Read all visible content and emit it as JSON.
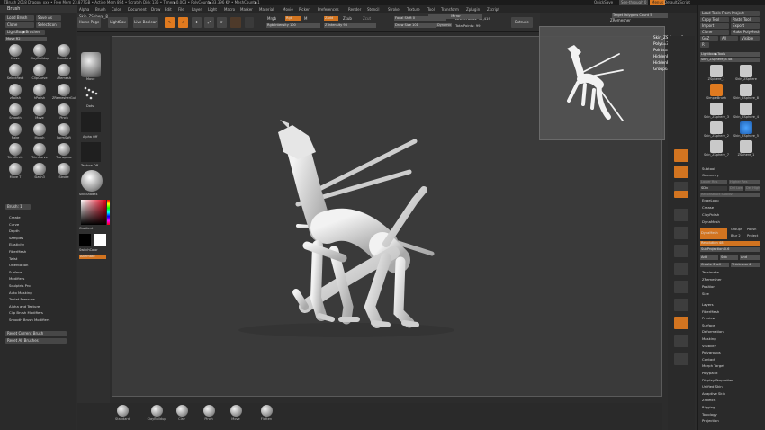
{
  "titlebar": {
    "text": "ZBrush 2018   Dragon_xxx  •  Free Mem 23.877GB  •  Active Mem 894  •  Scratch Disk 136  •  Timer▶0.003  •  PolyCount▶33.396 KP  •  MeshCount▶1",
    "quicksave": "QuickSave",
    "seethrough": "See-through   0",
    "menus_label": "Menus",
    "default_script": "DefaultZScript"
  },
  "menu": [
    "Alpha",
    "Brush",
    "Color",
    "Document",
    "Draw",
    "Edit",
    "File",
    "Layer",
    "Light",
    "Macro",
    "Marker",
    "Material",
    "Movie",
    "Picker",
    "Preferences",
    "Render",
    "Stencil",
    "Stroke",
    "Texture",
    "Tool",
    "Transform",
    "Zplugin",
    "Zscript"
  ],
  "brush_panel": {
    "title": "Brush",
    "buttons": [
      "Load Brush",
      "Save As",
      "Clone",
      "SelectIcon",
      "LightBox▶Brushes"
    ],
    "size_label": "Move  R2",
    "brushes": [
      "Move",
      "ClayBuildup",
      "Standard",
      "SelectRect",
      "ClipCurve",
      "zRemesh",
      "zPolish",
      "hPolish",
      "ZRemesherGuide",
      "Smooth",
      "Move",
      "Pinch",
      "Rake",
      "Morph",
      "FormSoft",
      "TrimCircle",
      "TrimCurve",
      "Transpose",
      "Move T",
      "Slash3",
      "Stroke"
    ],
    "stroke_label": "Brush: 1",
    "modifiers": [
      "Create",
      "Curve",
      "Depth",
      "Samples",
      "Elasticity",
      "FiberMesh",
      "Twist",
      "Orientation",
      "Surface",
      "Modifiers",
      "Sculptris Pro",
      "Auto Masking",
      "Tablet Pressure",
      "Alpha and Texture",
      "Clip Brush Modifiers",
      "Smooth Brush Modifiers"
    ],
    "reset_buttons": [
      "Reset Current Brush",
      "Reset All Brushes"
    ]
  },
  "shelf": {
    "tool_name": "Skin_ZSphere_8",
    "buttons": [
      "Home Page",
      "LightBox",
      "Live Boolean"
    ],
    "draw_labels": [
      "Edit",
      "Draw",
      "Move",
      "Scale",
      "Rotate"
    ],
    "mrgb": "Mrgb",
    "rgb": "Rgb",
    "m": "M",
    "rgb_intensity": "Rgb Intensity  100",
    "zadd": "Zadd",
    "zsub": "Zsub",
    "zcut": "Zcut",
    "z_intensity": "Z Intensity 93",
    "focal_shift": "Focal Shift  0",
    "draw_size": "Draw Size  101",
    "dynamic": "Dynamic",
    "active_points": "ActivePoints: 32,419",
    "total_points": "TotalPoints: 99",
    "extrude": "Extrude",
    "mirror": "Mirror",
    "zremesher": "ZRemesher",
    "target_polys": "Target Polygons Count  5"
  },
  "left_secondary": [
    "Move",
    "Dots",
    "Alpha Off",
    "Texture Off",
    "SkinShade4",
    "Gradient",
    "SwitchColor",
    "Alternate"
  ],
  "nav_info": {
    "name": "Skin_ZSphere_8",
    "polys": "Polys=33594",
    "points": "Points=32419",
    "hidden_polys": "HiddenPolys=0",
    "hidden_points": "HiddenPoints=0",
    "groups": "Groups=3"
  },
  "bottom_brushes": [
    "Standard",
    "ClayBuildup",
    "Clay",
    "Pinch",
    "Move",
    "Flatten"
  ],
  "right_panel": {
    "top_buttons": [
      "Load Tools From Project",
      "Copy Tool",
      "Paste Tool",
      "Import",
      "Export",
      "Clone",
      "Make PolyMesh3D",
      "GoZ",
      "All",
      "Visible",
      "R"
    ],
    "lightbox_tools": "Lightbox▶Tools",
    "zsphere_label": "Skin_ZSphere_8   48",
    "tools": [
      "ZSphere_1",
      "Skin_ZSphere",
      "SimpleBrush",
      "Skin_ZSphere_8",
      "Skin_ZSphere_3",
      "Skin_ZSphere_4",
      "Skin_ZSphere_2",
      "Skin_ZSphere_5",
      "Skin_ZSphere_7",
      "ZSphere_1"
    ],
    "sections": [
      "Subtool",
      "Geometry"
    ],
    "geometry_buttons": [
      "Lower Res",
      "Higher Res",
      "SDiv",
      "Del Lower",
      "Del Higher",
      "Reconstruct Subdiv",
      "EdgeLoop",
      "Crease",
      "ClayPolish",
      "DynaMesh"
    ],
    "dynamesh": {
      "label": "DynaMesh",
      "groups": "Groups",
      "polish": "Polish",
      "blur": "Blur 2",
      "project": "Project",
      "resolution": "Resolution 48",
      "subprojection": "SubProjection 0.6",
      "add": "Add",
      "sub": "Sub",
      "and": "And",
      "create_shell": "Create Shell",
      "thickness": "Thickness 4"
    },
    "more": [
      "Tessimate",
      "ZRemesher",
      "Position",
      "Size"
    ],
    "lower_list": [
      "Layers",
      "FiberMesh",
      "Preview",
      "Surface",
      "Deformation",
      "Masking",
      "Visibility",
      "Polygroups",
      "Contact",
      "Morph Target",
      "Polypaint",
      "Display Properties",
      "Unified Skin",
      "Adaptive Skin",
      "ZSketch",
      "Rigging",
      "Topology",
      "Projection"
    ]
  },
  "colors": {
    "accent": "#e07a1f",
    "bg": "#2c2c2c",
    "canvas": "#3a3a3a",
    "model": "#dcdcdc"
  }
}
